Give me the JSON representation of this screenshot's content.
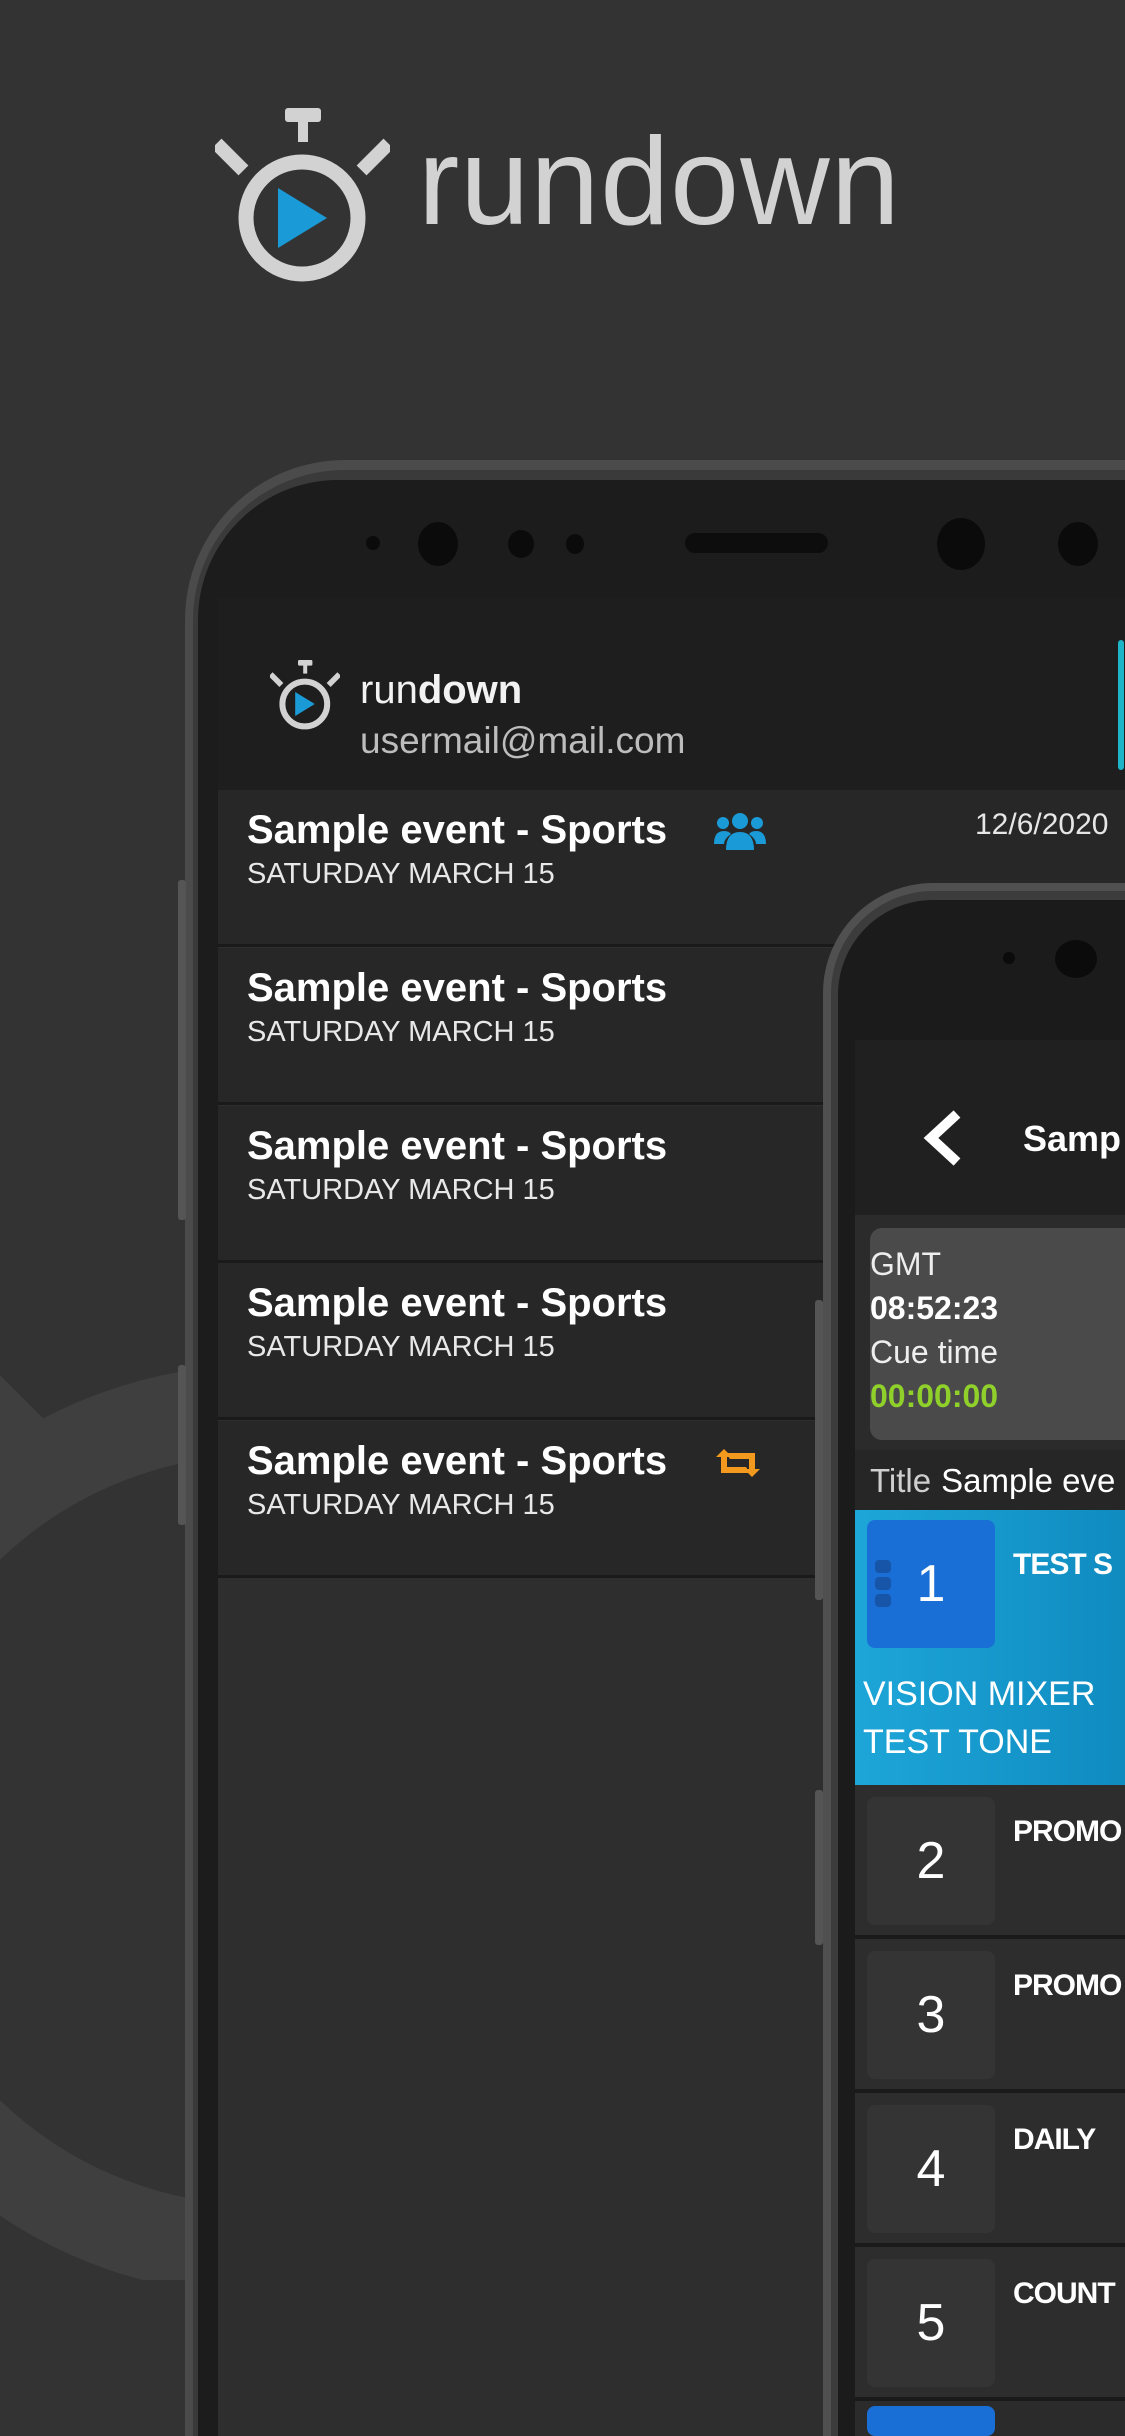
{
  "brand": {
    "name": "rundown",
    "accent": "#1a9ad6",
    "logo_color": "#d2d2d2"
  },
  "phone1": {
    "header": {
      "app_name_light": "run",
      "app_name_bold": "down",
      "email": "usermail@mail.com"
    },
    "events": [
      {
        "title": "Sample event - Sports",
        "subtitle": "SATURDAY MARCH 15",
        "icon": "users-icon",
        "icon_color": "#1a9ad6",
        "date": "12/6/2020"
      },
      {
        "title": "Sample event - Sports",
        "subtitle": "SATURDAY MARCH 15"
      },
      {
        "title": "Sample event - Sports",
        "subtitle": "SATURDAY MARCH 15"
      },
      {
        "title": "Sample event - Sports",
        "subtitle": "SATURDAY MARCH 15"
      },
      {
        "title": "Sample event - Sports",
        "subtitle": "SATURDAY MARCH 15",
        "icon": "repeat-icon",
        "icon_color": "#f39a1e"
      }
    ]
  },
  "phone2": {
    "header_title": "Samp",
    "clock": {
      "gmt_label": "GMT",
      "gmt_time": "08:52:23",
      "cue_label": "Cue time",
      "cue_time": "00:00:00",
      "cue_color": "#8fd12a"
    },
    "title_label": "Title",
    "title_value": "Sample eve",
    "rows": [
      {
        "number": "1",
        "title": "TEST S",
        "details": [
          "VISION MIXER",
          "TEST TONE"
        ],
        "active": true
      },
      {
        "number": "2",
        "title": "PROMO"
      },
      {
        "number": "3",
        "title": "PROMO"
      },
      {
        "number": "4",
        "title": "DAILY"
      },
      {
        "number": "5",
        "title": "COUNT"
      }
    ]
  }
}
